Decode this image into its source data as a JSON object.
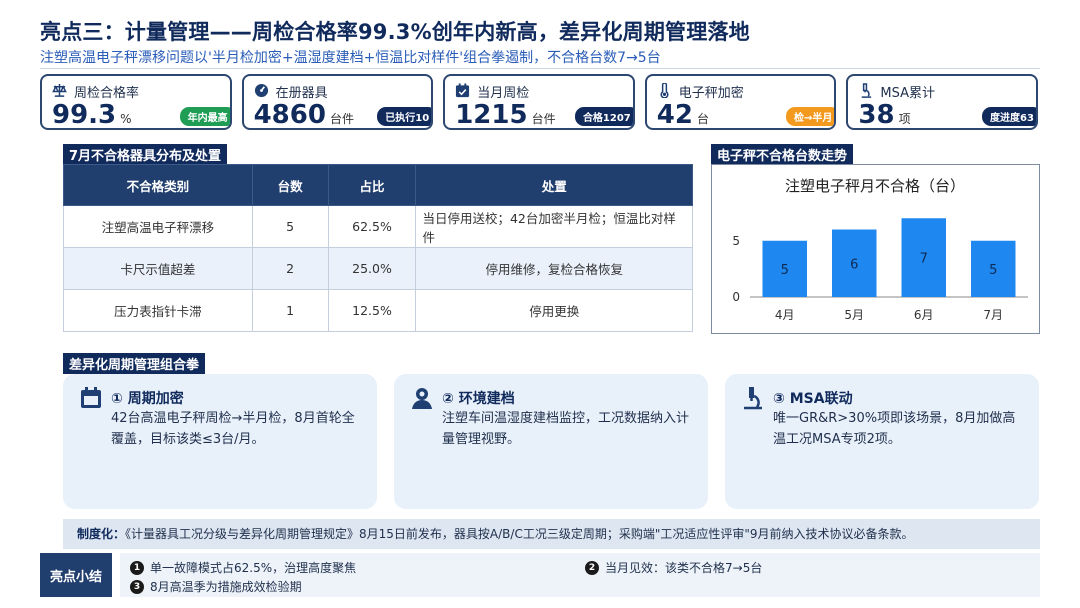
{
  "header": {
    "title": "亮点三：计量管理——周检合格率99.3%创年内新高，差异化周期管理落地",
    "subtitle": "注塑高温电子秤漂移问题以'半月检加密+温湿度建档+恒温比对样件'组合拳遏制，不合格台数7→5台"
  },
  "kpis": [
    {
      "icon": "scale-icon",
      "label": "周检合格率",
      "value": "99.3",
      "unit": "%",
      "badge": "年内最高",
      "badge_class": "b-green"
    },
    {
      "icon": "gauge-icon",
      "label": "在册器具",
      "value": "4860",
      "unit": "台件",
      "badge": "已执行10",
      "badge_class": "b-navy"
    },
    {
      "icon": "calendar-check-icon",
      "label": "当月周检",
      "value": "1215",
      "unit": "台件",
      "badge": "合格1207",
      "badge_class": "b-navy"
    },
    {
      "icon": "thermometer-icon",
      "label": "电子秤加密",
      "value": "42",
      "unit": "台",
      "badge": "检→半月",
      "badge_class": "b-orange"
    },
    {
      "icon": "microscope-icon",
      "label": "MSA累计",
      "value": "38",
      "unit": "项",
      "badge": "度进度63",
      "badge_class": "b-navy"
    }
  ],
  "table_section": {
    "label": "7月不合格器具分布及处置",
    "headers": [
      "不合格类别",
      "台数",
      "占比",
      "处置"
    ],
    "rows": [
      [
        "注塑高温电子秤漂移",
        "5",
        "62.5%",
        "当日停用送校；42台加密半月检；恒温比对样件"
      ],
      [
        "卡尺示值超差",
        "2",
        "25.0%",
        "停用维修，复检合格恢复"
      ],
      [
        "压力表指针卡滞",
        "1",
        "12.5%",
        "停用更换"
      ]
    ]
  },
  "chart_section": {
    "label": "电子秤不合格台数走势"
  },
  "chart_data": {
    "type": "bar",
    "title": "注塑电子秤月不合格（台）",
    "categories": [
      "4月",
      "5月",
      "6月",
      "7月"
    ],
    "values": [
      5,
      6,
      7,
      5
    ],
    "yticks": [
      "0",
      "5"
    ],
    "ylim": [
      0,
      8
    ],
    "bar_color": "#1e88f0",
    "grid": false,
    "legend": "none"
  },
  "combo_section": {
    "label": "差异化周期管理组合拳",
    "cards": [
      {
        "icon": "calendar-icon",
        "title": "① 周期加密",
        "body": "42台高温电子秤周检→半月检，8月首轮全覆盖，目标该类≤3台/月。"
      },
      {
        "icon": "user-icon",
        "title": "② 环境建档",
        "body": "注塑车间温湿度建档监控，工况数据纳入计量管理视野。"
      },
      {
        "icon": "microscope-icon",
        "title": "③ MSA联动",
        "body": "唯一GR&R>30%项即该场景，8月加做高温工况MSA专项2项。"
      }
    ]
  },
  "system": {
    "label": "制度化：",
    "text": "《计量器具工况分级与差异化周期管理规定》8月15日前发布，器具按A/B/C工况三级定周期；采购端\"工况适应性评审\"9月前纳入技术协议必备条款。"
  },
  "summary": {
    "label": "亮点小结",
    "items": [
      {
        "num": "1",
        "text": "单一故障模式占62.5%，治理高度聚焦"
      },
      {
        "num": "2",
        "text": "当月见效：该类不合格7→5台"
      },
      {
        "num": "3",
        "text": "8月高温季为措施成效检验期"
      }
    ]
  }
}
